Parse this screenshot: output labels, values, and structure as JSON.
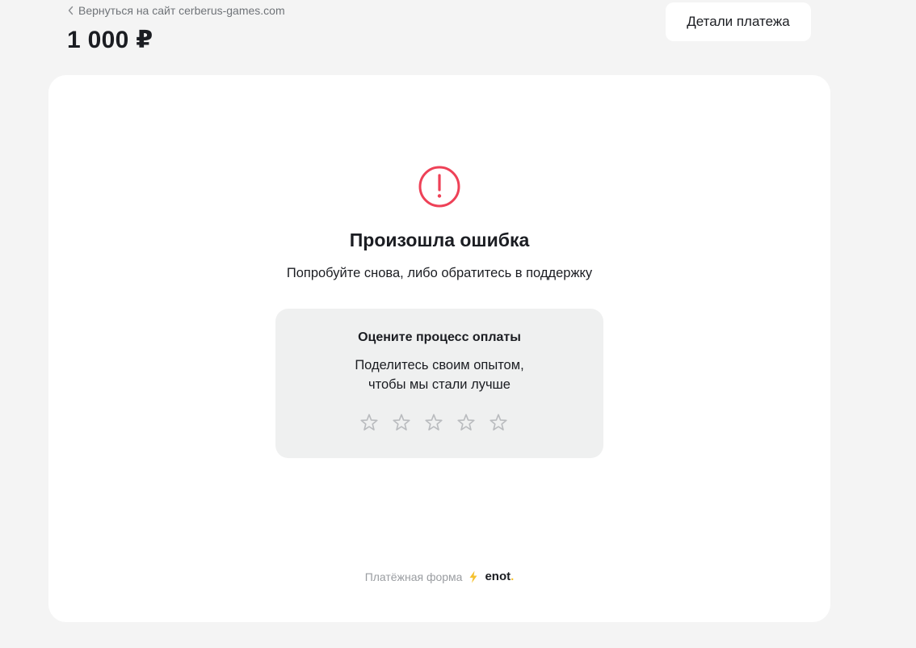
{
  "header": {
    "back_link": "Вернуться на сайт cerberus-games.com",
    "amount": "1 000 ₽",
    "details_button": "Детали платежа"
  },
  "error": {
    "icon": "exclamation-circle-icon",
    "title": "Произошла ошибка",
    "subtitle": "Попробуйте снова, либо обратитесь в поддержку"
  },
  "rating": {
    "title": "Оцените процесс оплаты",
    "text_line1": "Поделитесь своим опытом,",
    "text_line2": "чтобы мы стали лучше",
    "stars_total": 5,
    "stars_selected": 0
  },
  "footer": {
    "label": "Платёжная форма",
    "brand": "enot",
    "brand_dot": "."
  },
  "colors": {
    "background": "#f4f4f4",
    "card": "#ffffff",
    "error": "#ee4157",
    "brand_accent": "#f5c12e",
    "star": "#b9bbbe"
  }
}
